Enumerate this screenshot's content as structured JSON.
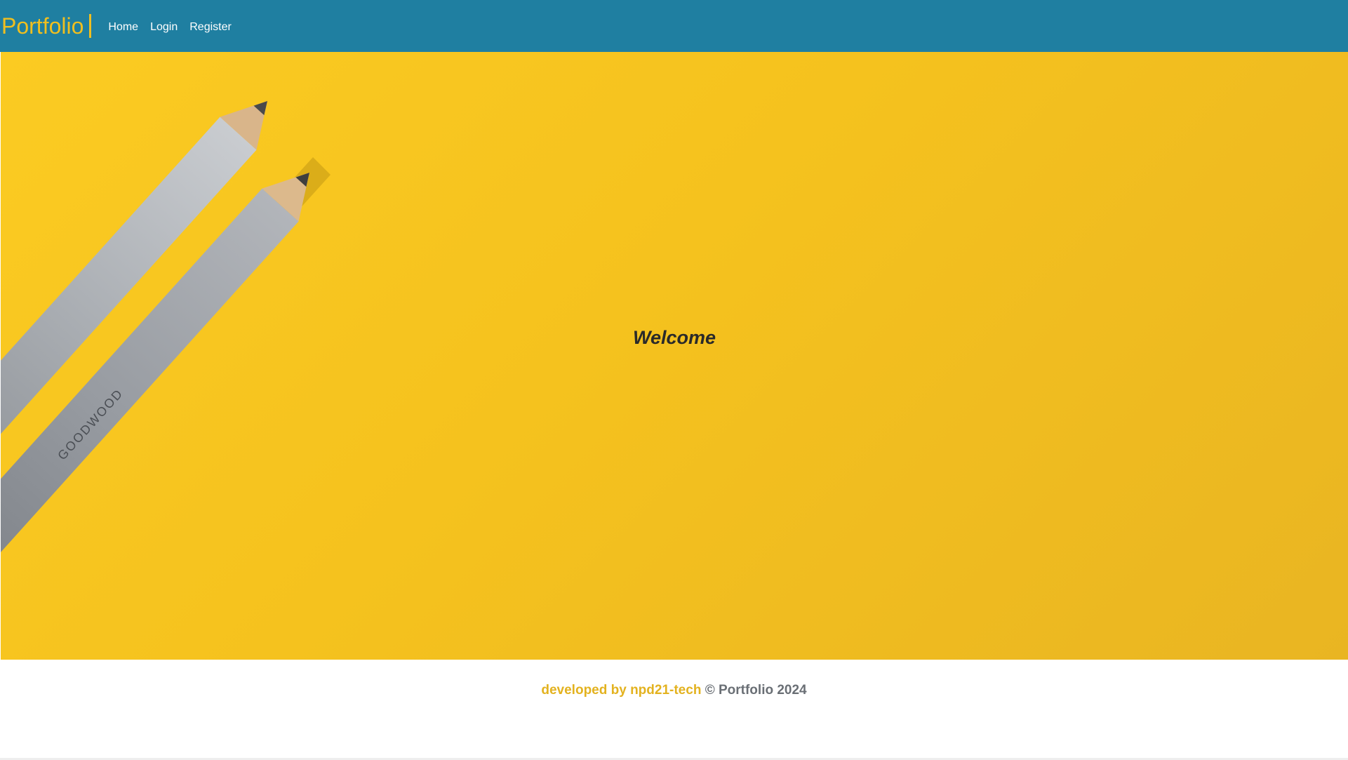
{
  "navbar": {
    "brand": "Portfolio",
    "links": [
      "Home",
      "Login",
      "Register"
    ]
  },
  "hero": {
    "heading": "Welcome",
    "pencil_label": "GOODWOOD"
  },
  "footer": {
    "developer_text": "developed by npd21-tech",
    "copyright_text": "© Portfolio 2024"
  },
  "colors": {
    "navbar_bg": "#1f7fa1",
    "brand": "#f0bf1f",
    "hero_bg": "#f5c21e",
    "footer_accent": "#e3b21f",
    "footer_muted": "#6a6f75"
  }
}
